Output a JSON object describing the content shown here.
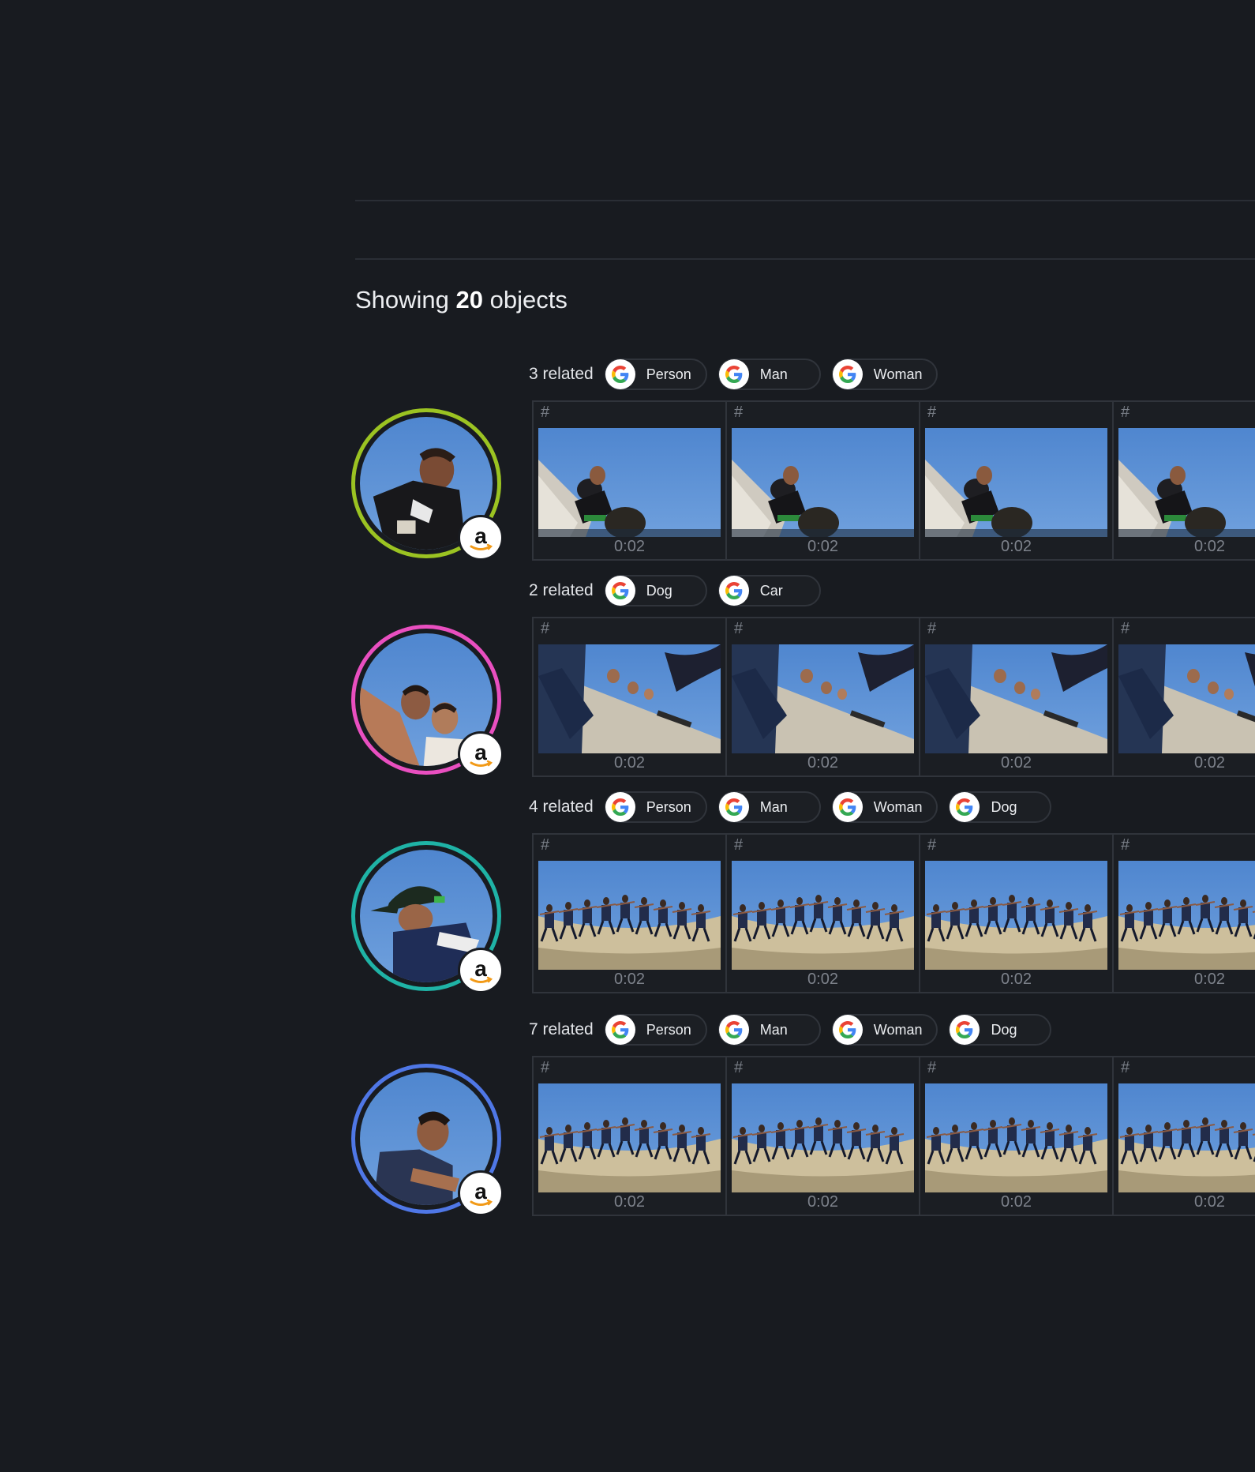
{
  "summary": {
    "prefix": "Showing",
    "count": "20",
    "suffix": "objects"
  },
  "groups": [
    {
      "avatar_color": "#9bc322",
      "avatar_scene": "person-closeup",
      "related": "3 related",
      "tags": [
        "Person",
        "Man",
        "Woman"
      ],
      "frame_scene": "skater-below",
      "frames": [
        {
          "hash": "#",
          "time": "0:02"
        },
        {
          "hash": "#",
          "time": "0:02"
        },
        {
          "hash": "#",
          "time": "0:02"
        },
        {
          "hash": "#",
          "time": "0:02"
        }
      ]
    },
    {
      "avatar_color": "#e94fc0",
      "avatar_scene": "two-faces",
      "related": "2 related",
      "tags": [
        "Dog",
        "Car"
      ],
      "frame_scene": "skater-ramp",
      "frames": [
        {
          "hash": "#",
          "time": "0:02"
        },
        {
          "hash": "#",
          "time": "0:02"
        },
        {
          "hash": "#",
          "time": "0:02"
        },
        {
          "hash": "#",
          "time": "0:02"
        }
      ]
    },
    {
      "avatar_color": "#1fb3a6",
      "avatar_scene": "cap-man",
      "related": "4 related",
      "tags": [
        "Person",
        "Man",
        "Woman",
        "Dog"
      ],
      "frame_scene": "skater-sequence",
      "frames": [
        {
          "hash": "#",
          "time": "0:02"
        },
        {
          "hash": "#",
          "time": "0:02"
        },
        {
          "hash": "#",
          "time": "0:02"
        },
        {
          "hash": "#",
          "time": "0:02"
        }
      ]
    },
    {
      "avatar_color": "#4f77e6",
      "avatar_scene": "person-side",
      "related": "7 related",
      "tags": [
        "Person",
        "Man",
        "Woman",
        "Dog"
      ],
      "frame_scene": "skater-sequence",
      "frames": [
        {
          "hash": "#",
          "time": "0:02"
        },
        {
          "hash": "#",
          "time": "0:02"
        },
        {
          "hash": "#",
          "time": "0:02"
        },
        {
          "hash": "#",
          "time": "0:02"
        }
      ]
    }
  ],
  "icons": {
    "tag_logo": "google-g-icon",
    "badge_logo": "amazon-a-icon"
  }
}
